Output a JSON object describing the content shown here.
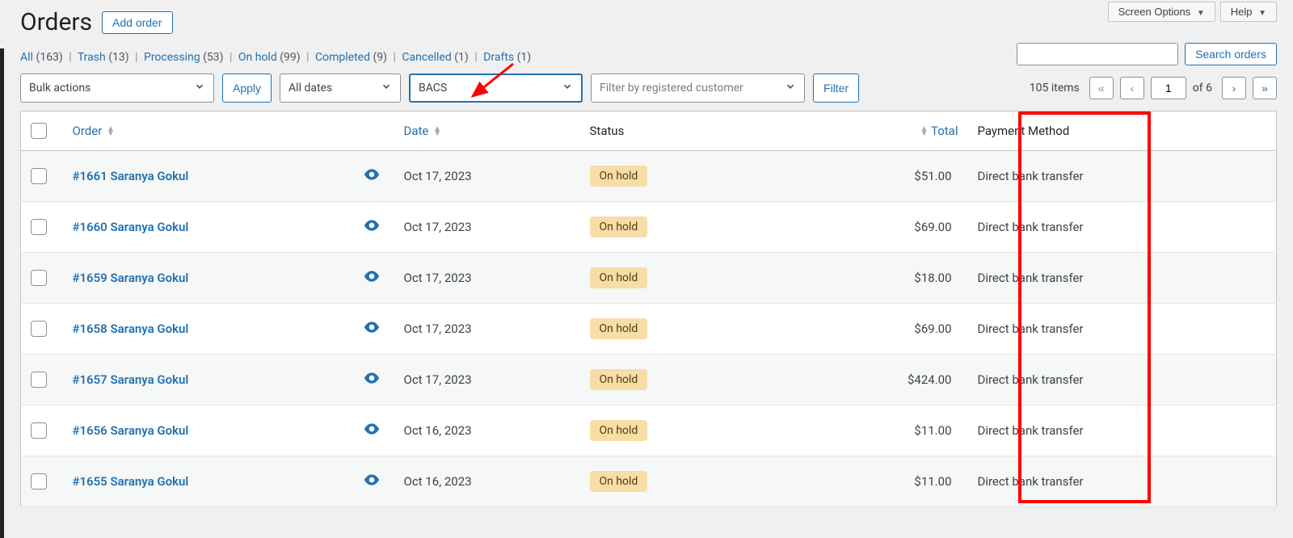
{
  "topButtons": {
    "screenOptions": "Screen Options",
    "help": "Help"
  },
  "page": {
    "title": "Orders",
    "addButton": "Add order"
  },
  "statusFilters": [
    {
      "label": "All",
      "count": "(163)"
    },
    {
      "label": "Trash",
      "count": "(13)"
    },
    {
      "label": "Processing",
      "count": "(53)"
    },
    {
      "label": "On hold",
      "count": "(99)"
    },
    {
      "label": "Completed",
      "count": "(9)"
    },
    {
      "label": "Cancelled",
      "count": "(1)"
    },
    {
      "label": "Drafts",
      "count": "(1)"
    }
  ],
  "search": {
    "button": "Search orders",
    "value": ""
  },
  "filters": {
    "bulkActions": "Bulk actions",
    "apply": "Apply",
    "dates": "All dates",
    "payment": "BACS",
    "customer": "Filter by registered customer",
    "filterBtn": "Filter"
  },
  "pagination": {
    "itemsText": "105 items",
    "ofText": "of 6",
    "current": "1",
    "firstGlyph": "«",
    "prevGlyph": "‹",
    "nextGlyph": "›",
    "lastGlyph": "»"
  },
  "columns": {
    "order": "Order",
    "date": "Date",
    "status": "Status",
    "total": "Total",
    "payment": "Payment Method"
  },
  "rows": [
    {
      "order": "#1661 Saranya Gokul",
      "date": "Oct 17, 2023",
      "status": "On hold",
      "total": "$51.00",
      "payment": "Direct bank transfer"
    },
    {
      "order": "#1660 Saranya Gokul",
      "date": "Oct 17, 2023",
      "status": "On hold",
      "total": "$69.00",
      "payment": "Direct bank transfer"
    },
    {
      "order": "#1659 Saranya Gokul",
      "date": "Oct 17, 2023",
      "status": "On hold",
      "total": "$18.00",
      "payment": "Direct bank transfer"
    },
    {
      "order": "#1658 Saranya Gokul",
      "date": "Oct 17, 2023",
      "status": "On hold",
      "total": "$69.00",
      "payment": "Direct bank transfer"
    },
    {
      "order": "#1657 Saranya Gokul",
      "date": "Oct 17, 2023",
      "status": "On hold",
      "total": "$424.00",
      "payment": "Direct bank transfer"
    },
    {
      "order": "#1656 Saranya Gokul",
      "date": "Oct 16, 2023",
      "status": "On hold",
      "total": "$11.00",
      "payment": "Direct bank transfer"
    },
    {
      "order": "#1655 Saranya Gokul",
      "date": "Oct 16, 2023",
      "status": "On hold",
      "total": "$11.00",
      "payment": "Direct bank transfer"
    }
  ]
}
